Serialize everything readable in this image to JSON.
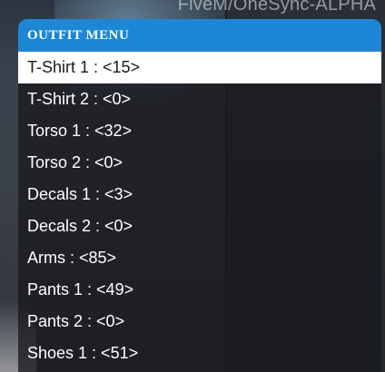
{
  "watermark": "FiveM/OneSync-ALPHA",
  "menu": {
    "title": "OUTFIT MENU",
    "selected_index": 0,
    "items": [
      {
        "label": "T-Shirt 1 : <15>"
      },
      {
        "label": "T-Shirt 2 : <0>"
      },
      {
        "label": "Torso 1 : <32>"
      },
      {
        "label": "Torso 2 : <0>"
      },
      {
        "label": "Decals 1 : <3>"
      },
      {
        "label": "Decals 2 : <0>"
      },
      {
        "label": "Arms : <85>"
      },
      {
        "label": "Pants 1 : <49>"
      },
      {
        "label": "Pants 2 : <0>"
      },
      {
        "label": "Shoes 1 : <51>"
      }
    ]
  },
  "colors": {
    "header": "#1e86d6",
    "selected_bg": "#ffffff",
    "item_text": "#ffffff"
  }
}
